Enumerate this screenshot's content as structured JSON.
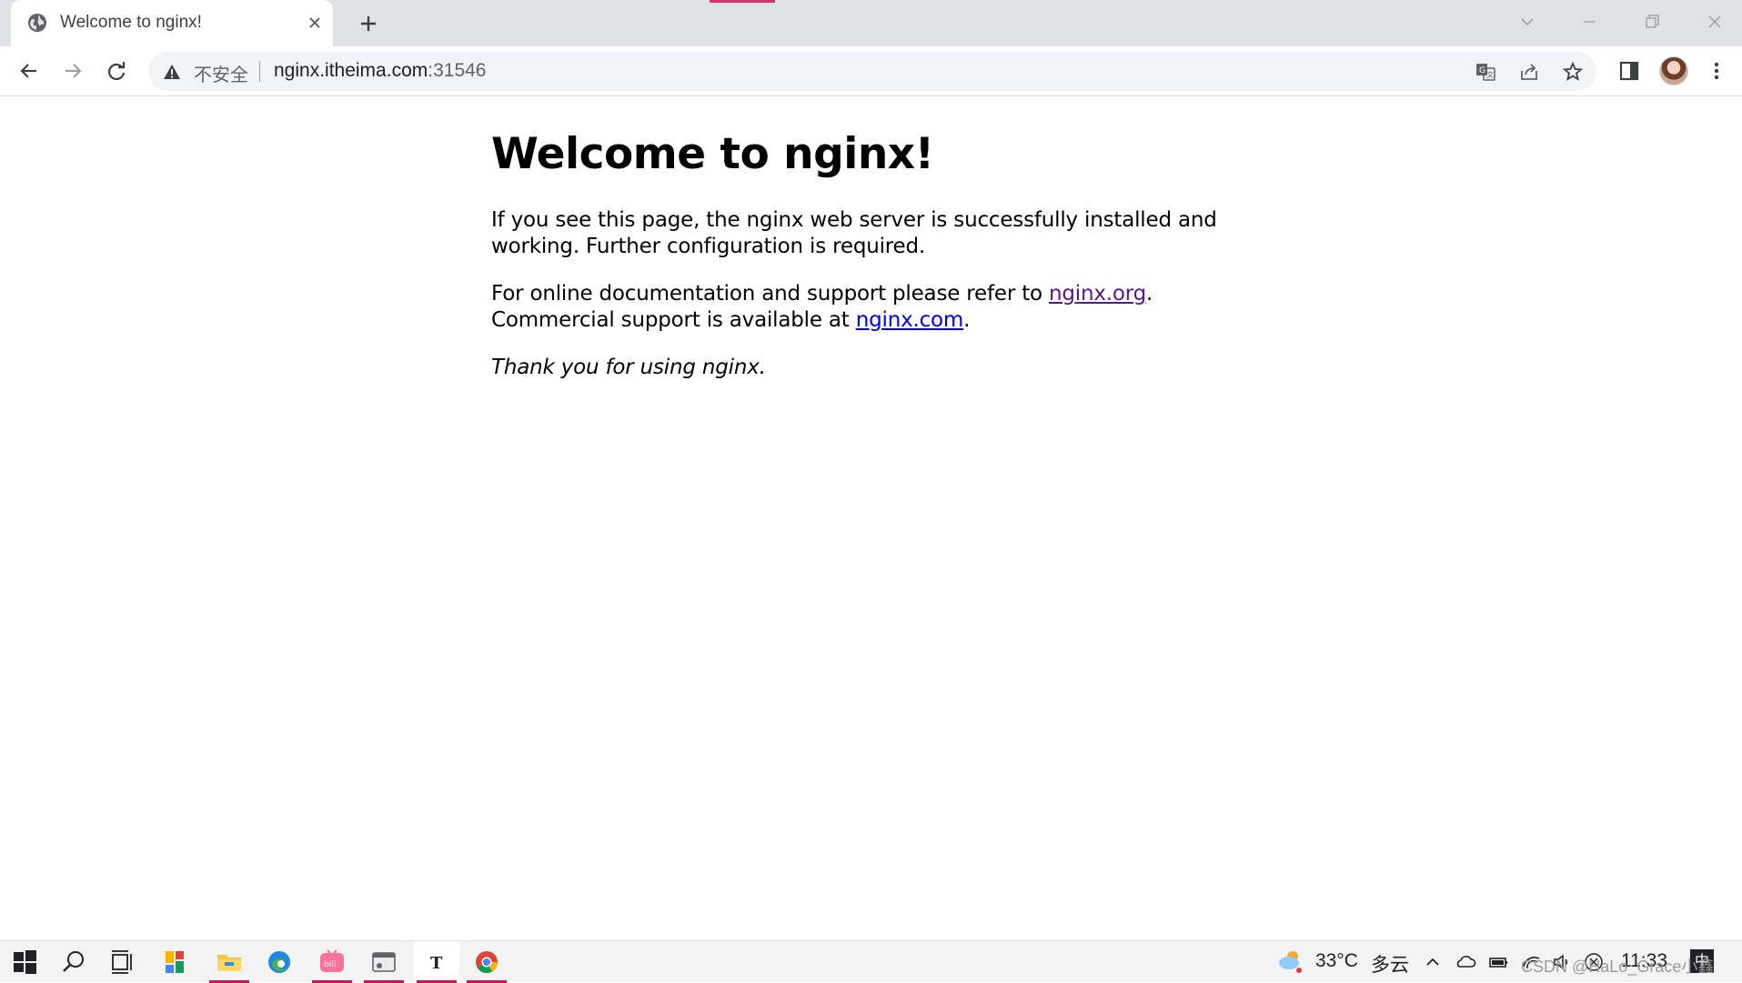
{
  "tab": {
    "title": "Welcome to nginx!"
  },
  "omnibox": {
    "security_label": "不安全",
    "url_host": "nginx.itheima.com",
    "url_port": ":31546"
  },
  "page": {
    "heading": "Welcome to nginx!",
    "para1": "If you see this page, the nginx web server is successfully installed and working. Further configuration is required.",
    "para2_prefix": "For online documentation and support please refer to ",
    "link_org": "nginx.org",
    "para2_mid": ".",
    "para2_line2_prefix": "Commercial support is available at ",
    "link_com": "nginx.com",
    "para2_suffix": ".",
    "para3": "Thank you for using nginx."
  },
  "taskbar": {
    "apps": [
      "start-icon",
      "search-icon",
      "task-view-icon",
      "widgets-icon",
      "file-explorer-icon",
      "edge-icon",
      "bilibili-icon",
      "window-app-icon",
      "typora-icon",
      "chrome-icon"
    ],
    "weather_temp": "33°C",
    "weather_desc": "多云",
    "clock": "11:33",
    "ime": "中",
    "watermark": "CSDN @HaLo_Grace小鑫"
  },
  "colors": {
    "link": "#0000ee",
    "visited_link": "#551a8b",
    "accent": "#d6336c",
    "tab_strip": "#dee1e6",
    "omnibox": "#f1f3f4"
  }
}
